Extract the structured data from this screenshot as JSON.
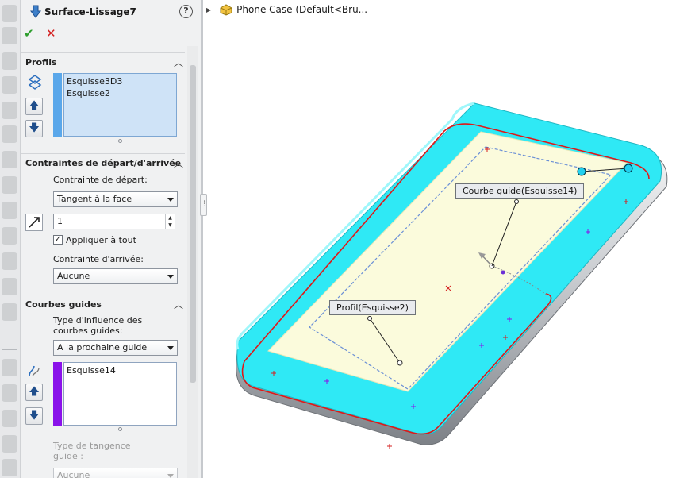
{
  "feature": {
    "title": "Surface-Lissage7",
    "help": "?",
    "ok_glyph": "✔",
    "cancel_glyph": "✕"
  },
  "profiles": {
    "header": "Profils",
    "items": [
      "Esquisse3D3",
      "Esquisse2"
    ],
    "color": "#5aa7ea"
  },
  "constraints": {
    "header": "Contraintes de départ/d'arrivée",
    "start_label": "Contrainte de départ:",
    "start_value": "Tangent à la face",
    "length_value": "1",
    "apply_all_label": "Appliquer à tout",
    "apply_all_checked": true,
    "end_label": "Contrainte d'arrivée:",
    "end_value": "Aucune"
  },
  "guides": {
    "header": "Courbes guides",
    "influence_label": "Type d'influence des courbes guides:",
    "influence_value": "A la prochaine guide",
    "items": [
      "Esquisse14"
    ],
    "color": "#8a12ea",
    "tangency_label": "Type de tangence guide :",
    "tangency_value": "Aucune"
  },
  "tree": {
    "part_name": "Phone Case  (Default<Bru..."
  },
  "viewport": {
    "callout_guide": "Courbe guide(Esquisse14)",
    "callout_profile": "Profil(Esquisse2)",
    "colors": {
      "surface": "#2fe9f5",
      "inner": "#fbfbdc",
      "edge": "#e01818",
      "sketch": "#6a8fd6"
    }
  }
}
